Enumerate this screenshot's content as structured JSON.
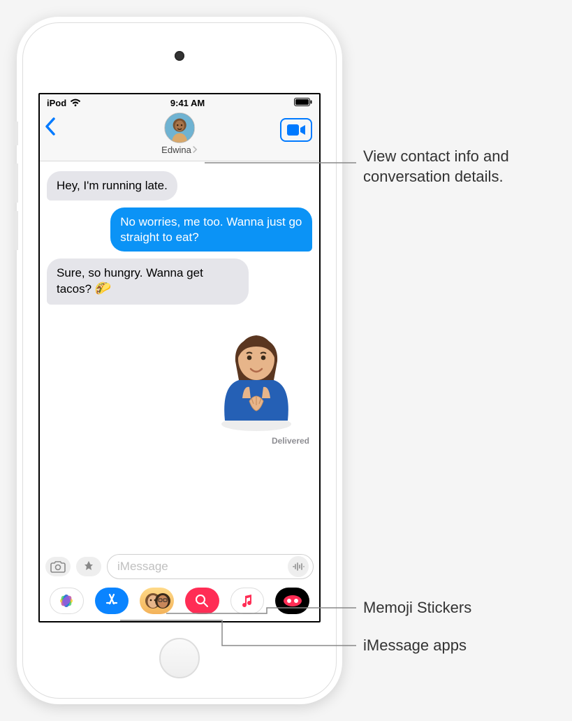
{
  "status": {
    "carrier": "iPod",
    "time": "9:41 AM"
  },
  "header": {
    "contact_name": "Edwina"
  },
  "messages": {
    "m1": "Hey, I'm running late.",
    "m2": "No worries, me too. Wanna just go straight to eat?",
    "m3_pre": "Sure, so hungry. Wanna get tacos? ",
    "m3_emoji": "🌮",
    "delivered": "Delivered"
  },
  "composer": {
    "placeholder": "iMessage"
  },
  "drawer": {
    "photos": "photos-app",
    "store": "imessage-store-app",
    "memoji": "memoji-stickers-app",
    "images": "images-search-app",
    "music": "apple-music-app",
    "game": "game-pigeon-app"
  },
  "callouts": {
    "contact_info_l1": "View contact info and",
    "contact_info_l2": "conversation details.",
    "memoji": "Memoji Stickers",
    "apps": "iMessage apps"
  }
}
